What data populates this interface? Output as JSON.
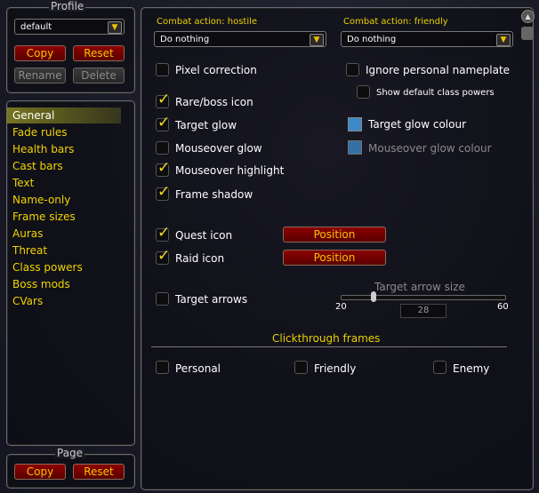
{
  "profile": {
    "legend": "Profile",
    "selected": "default",
    "copy": "Copy",
    "reset": "Reset",
    "rename": "Rename",
    "delete": "Delete"
  },
  "nav": {
    "items": [
      "General",
      "Fade rules",
      "Health bars",
      "Cast bars",
      "Text",
      "Name-only",
      "Frame sizes",
      "Auras",
      "Threat",
      "Class powers",
      "Boss mods",
      "CVars"
    ],
    "active": "General"
  },
  "page": {
    "legend": "Page",
    "copy": "Copy",
    "reset": "Reset"
  },
  "main": {
    "hostile": {
      "label": "Combat action: hostile",
      "value": "Do nothing"
    },
    "friendly": {
      "label": "Combat action: friendly",
      "value": "Do nothing"
    },
    "checks": {
      "pixel": {
        "label": "Pixel correction",
        "checked": false
      },
      "rare": {
        "label": "Rare/boss icon",
        "checked": true
      },
      "tglow": {
        "label": "Target glow",
        "checked": true
      },
      "mglow": {
        "label": "Mouseover glow",
        "checked": false
      },
      "mhl": {
        "label": "Mouseover highlight",
        "checked": true
      },
      "shadow": {
        "label": "Frame shadow",
        "checked": true
      },
      "quest": {
        "label": "Quest icon",
        "checked": true
      },
      "raid": {
        "label": "Raid icon",
        "checked": true
      },
      "arrows": {
        "label": "Target arrows",
        "checked": false
      },
      "ignore": {
        "label": "Ignore personal nameplate",
        "checked": false
      },
      "showdef": {
        "label": "Show default class powers",
        "checked": false
      }
    },
    "colours": {
      "tglow": {
        "label": "Target glow colour",
        "color": "#3d88c8"
      },
      "mglow": {
        "label": "Mouseover glow colour",
        "color": "#3d88c8"
      }
    },
    "position": "Position",
    "slider": {
      "label": "Target arrow size",
      "min": "20",
      "max": "60",
      "value": "28"
    },
    "clickthrough": {
      "title": "Clickthrough frames",
      "personal": "Personal",
      "friendly": "Friendly",
      "enemy": "Enemy"
    }
  }
}
